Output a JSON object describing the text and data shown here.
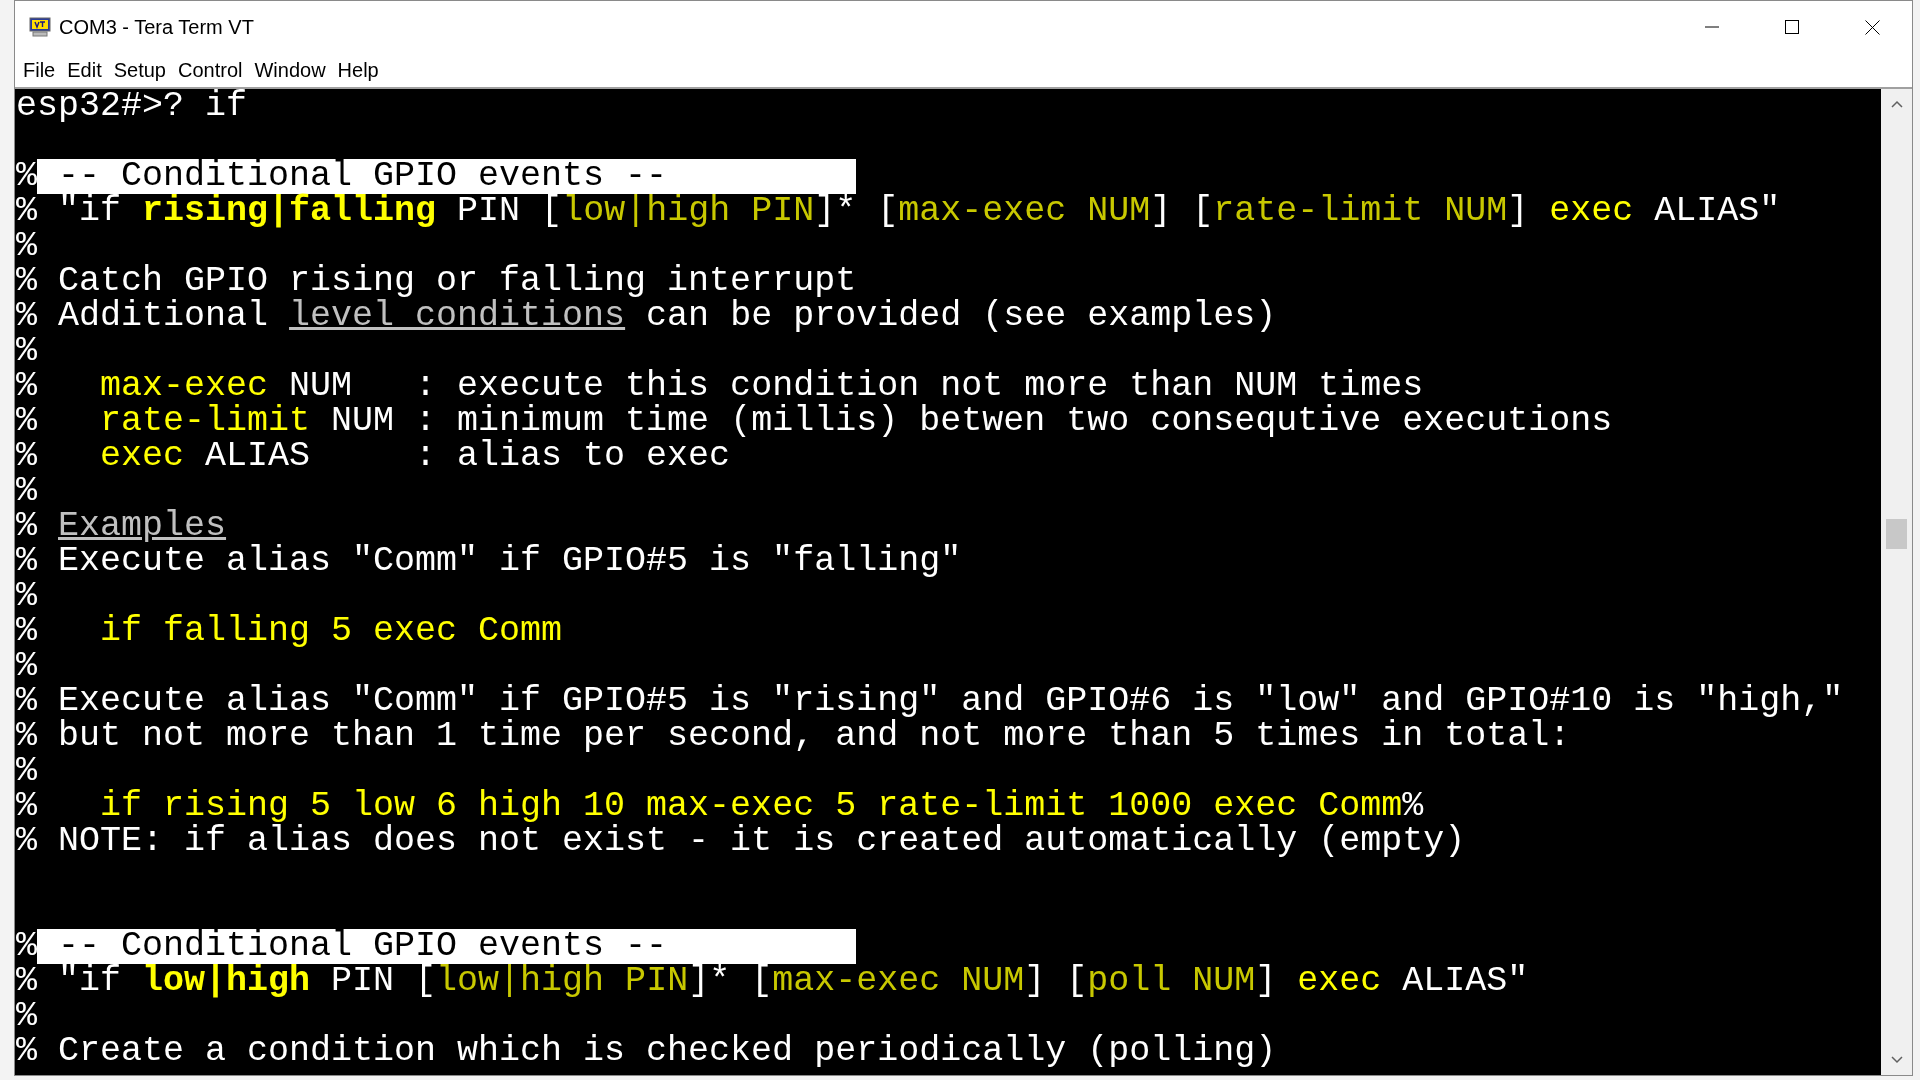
{
  "window": {
    "title": "COM3 - Tera Term VT"
  },
  "menu": [
    "File",
    "Edit",
    "Setup",
    "Control",
    "Window",
    "Help"
  ],
  "terminal": {
    "lines": [
      {
        "kind": "text",
        "segments": [
          {
            "text": "esp32#>? if",
            "kind": "plain"
          }
        ]
      },
      {
        "kind": "blank"
      },
      {
        "kind": "text",
        "segments": [
          {
            "text": "%",
            "kind": "plain"
          },
          {
            "text": " -- Conditional GPIO events --",
            "kind": "inverse"
          }
        ]
      },
      {
        "kind": "text",
        "segments": [
          {
            "text": "% \"if ",
            "kind": "plain"
          },
          {
            "text": "rising|falling",
            "kind": "bold"
          },
          {
            "text": " PIN [",
            "kind": "plain"
          },
          {
            "text": "low|high PIN",
            "kind": "dim"
          },
          {
            "text": "]* [",
            "kind": "plain"
          },
          {
            "text": "max-exec NUM",
            "kind": "dim"
          },
          {
            "text": "] [",
            "kind": "plain"
          },
          {
            "text": "rate-limit NUM",
            "kind": "dim"
          },
          {
            "text": "] ",
            "kind": "plain"
          },
          {
            "text": "exec",
            "kind": "bright"
          },
          {
            "text": " ALIAS\"",
            "kind": "plain"
          }
        ]
      },
      {
        "kind": "text",
        "segments": [
          {
            "text": "%",
            "kind": "plain"
          }
        ]
      },
      {
        "kind": "text",
        "segments": [
          {
            "text": "% Catch GPIO rising or falling interrupt",
            "kind": "plain"
          }
        ]
      },
      {
        "kind": "text",
        "segments": [
          {
            "text": "% Additional ",
            "kind": "plain"
          },
          {
            "text": "level conditions",
            "kind": "link"
          },
          {
            "text": " can be provided (see examples)",
            "kind": "plain"
          }
        ]
      },
      {
        "kind": "text",
        "segments": [
          {
            "text": "%",
            "kind": "plain"
          }
        ]
      },
      {
        "kind": "text",
        "segments": [
          {
            "text": "%   ",
            "kind": "plain"
          },
          {
            "text": "max-exec",
            "kind": "bright"
          },
          {
            "text": " NUM   : execute this condition not more than NUM times",
            "kind": "plain"
          }
        ]
      },
      {
        "kind": "text",
        "segments": [
          {
            "text": "%   ",
            "kind": "plain"
          },
          {
            "text": "rate-limit",
            "kind": "bright"
          },
          {
            "text": " NUM : minimum time (millis) betwen two consequtive executions",
            "kind": "plain"
          }
        ]
      },
      {
        "kind": "text",
        "segments": [
          {
            "text": "%   ",
            "kind": "plain"
          },
          {
            "text": "exec",
            "kind": "bright"
          },
          {
            "text": " ALIAS     : alias to exec",
            "kind": "plain"
          }
        ]
      },
      {
        "kind": "text",
        "segments": [
          {
            "text": "%",
            "kind": "plain"
          }
        ]
      },
      {
        "kind": "text",
        "segments": [
          {
            "text": "% ",
            "kind": "plain"
          },
          {
            "text": "Examples",
            "kind": "link"
          }
        ]
      },
      {
        "kind": "text",
        "segments": [
          {
            "text": "% Execute alias \"Comm\" if GPIO#5 is \"falling\"",
            "kind": "plain"
          }
        ]
      },
      {
        "kind": "text",
        "segments": [
          {
            "text": "%",
            "kind": "plain"
          }
        ]
      },
      {
        "kind": "text",
        "segments": [
          {
            "text": "%   ",
            "kind": "plain"
          },
          {
            "text": "if falling 5 exec Comm",
            "kind": "bright"
          }
        ]
      },
      {
        "kind": "text",
        "segments": [
          {
            "text": "%",
            "kind": "plain"
          }
        ]
      },
      {
        "kind": "text",
        "segments": [
          {
            "text": "% Execute alias \"Comm\" if GPIO#5 is \"rising\" and GPIO#6 is \"low\" and GPIO#10 is \"high,\"",
            "kind": "plain"
          }
        ]
      },
      {
        "kind": "text",
        "segments": [
          {
            "text": "% but not more than 1 time per second, and not more than 5 times in total:",
            "kind": "plain"
          }
        ]
      },
      {
        "kind": "text",
        "segments": [
          {
            "text": "%",
            "kind": "plain"
          }
        ]
      },
      {
        "kind": "text",
        "segments": [
          {
            "text": "%   ",
            "kind": "plain"
          },
          {
            "text": "if rising 5 low 6 high 10 max-exec 5 rate-limit 1000 exec Comm",
            "kind": "bright"
          },
          {
            "text": "%",
            "kind": "plain"
          }
        ]
      },
      {
        "kind": "text",
        "segments": [
          {
            "text": "% NOTE: if alias does not exist - it is created automatically (empty)",
            "kind": "plain"
          }
        ]
      },
      {
        "kind": "blank"
      },
      {
        "kind": "blank"
      },
      {
        "kind": "text",
        "segments": [
          {
            "text": "%",
            "kind": "plain"
          },
          {
            "text": " -- Conditional GPIO events --",
            "kind": "inverse"
          }
        ]
      },
      {
        "kind": "text",
        "segments": [
          {
            "text": "% \"if ",
            "kind": "plain"
          },
          {
            "text": "low|high",
            "kind": "bold"
          },
          {
            "text": " PIN [",
            "kind": "plain"
          },
          {
            "text": "low|high PIN",
            "kind": "dim"
          },
          {
            "text": "]* [",
            "kind": "plain"
          },
          {
            "text": "max-exec NUM",
            "kind": "dim"
          },
          {
            "text": "] [",
            "kind": "plain"
          },
          {
            "text": "poll NUM",
            "kind": "dim"
          },
          {
            "text": "] ",
            "kind": "plain"
          },
          {
            "text": "exec",
            "kind": "bright"
          },
          {
            "text": " ALIAS\"",
            "kind": "plain"
          }
        ]
      },
      {
        "kind": "text",
        "segments": [
          {
            "text": "%",
            "kind": "plain"
          }
        ]
      },
      {
        "kind": "text",
        "segments": [
          {
            "text": "% Create a condition which is checked periodically (polling)",
            "kind": "plain"
          }
        ]
      }
    ]
  }
}
